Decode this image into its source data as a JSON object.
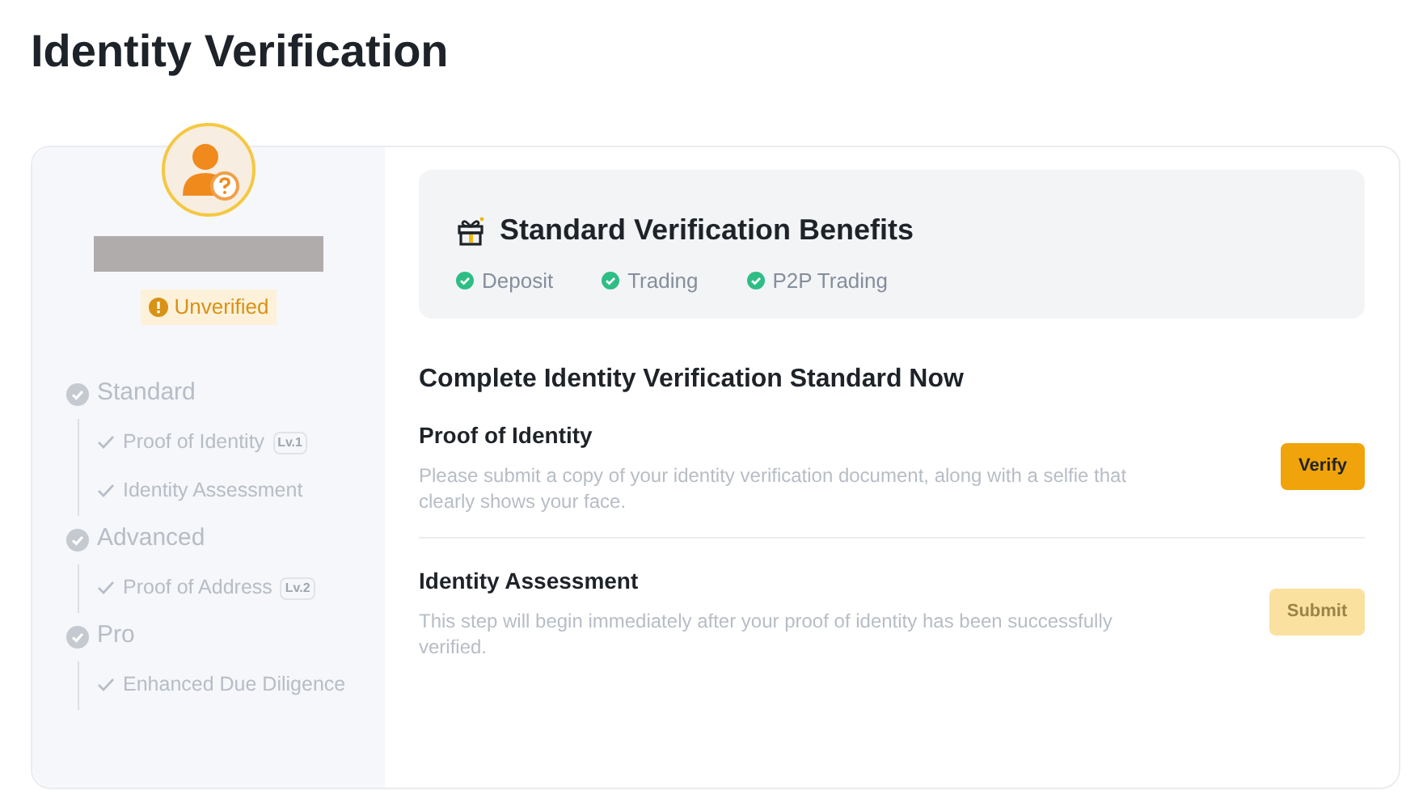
{
  "page_title": "Identity Verification",
  "profile": {
    "status": "Unverified"
  },
  "levels": [
    {
      "label": "Standard",
      "children": [
        {
          "label": "Proof of Identity",
          "badge": "Lv.1"
        },
        {
          "label": "Identity Assessment"
        }
      ]
    },
    {
      "label": "Advanced",
      "children": [
        {
          "label": "Proof of Address",
          "badge": "Lv.2"
        }
      ]
    },
    {
      "label": "Pro",
      "children": [
        {
          "label": "Enhanced Due Diligence"
        }
      ]
    }
  ],
  "benefits": {
    "title": "Standard Verification Benefits",
    "items": [
      "Deposit",
      "Trading",
      "P2P Trading"
    ]
  },
  "section_title": "Complete Identity Verification Standard Now",
  "steps": [
    {
      "title": "Proof of Identity",
      "description": "Please submit a copy of your identity verification document, along with a selfie that clearly shows your face.",
      "button": {
        "label": "Verify",
        "disabled": false
      }
    },
    {
      "title": "Identity Assessment",
      "description": "This step will begin immediately after your proof of identity has been successfully verified.",
      "button": {
        "label": "Submit",
        "disabled": true
      }
    }
  ]
}
